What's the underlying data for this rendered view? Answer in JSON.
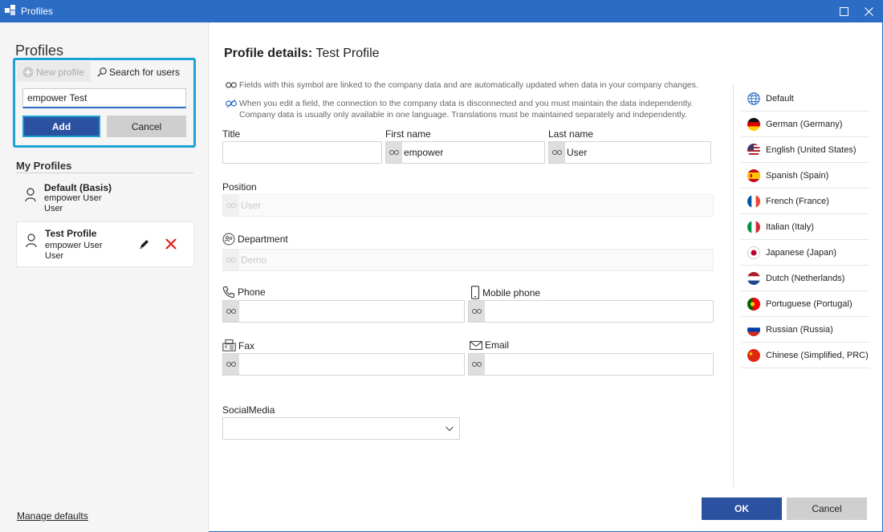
{
  "window": {
    "title": "Profiles",
    "maximize_icon": "maximize-icon",
    "close_icon": "close-icon"
  },
  "sidebar": {
    "title": "Profiles",
    "new_profile_label": "New profile",
    "search_users_label": "Search for users",
    "name_input_value": "empower Test",
    "add_label": "Add",
    "cancel_label": "Cancel",
    "my_profiles_heading": "My Profiles",
    "profiles": [
      {
        "name": "Default (Basis)",
        "line1": "empower User",
        "line2": "User"
      },
      {
        "name": "Test Profile",
        "line1": "empower User",
        "line2": "User"
      }
    ],
    "manage_defaults_label": "Manage defaults"
  },
  "main": {
    "title_bold": "Profile details:",
    "title_rest": " Test Profile",
    "info_linked": "Fields with this symbol are linked to the company data and are automatically updated when data in your company changes.",
    "info_unlinked_1": "When you edit a field, the connection to the company data is disconnected and you must maintain the data independently.",
    "info_unlinked_2": "Company data is usually only available in one language. Translations must be maintained separately and independently.",
    "fields": {
      "title_label": "Title",
      "title_value": "",
      "first_name_label": "First name",
      "first_name_value": "empower",
      "last_name_label": "Last name",
      "last_name_value": "User",
      "position_label": "Position",
      "position_value": "User",
      "department_label": "Department",
      "department_value": "Demo",
      "phone_label": "Phone",
      "phone_value": "",
      "mobile_label": "Mobile phone",
      "mobile_value": "",
      "fax_label": "Fax",
      "fax_value": "",
      "email_label": "Email",
      "email_value": "",
      "social_label": "SocialMedia",
      "social_value": ""
    }
  },
  "languages": [
    "Default",
    "German (Germany)",
    "English (United States)",
    "Spanish (Spain)",
    "French (France)",
    "Italian (Italy)",
    "Japanese (Japan)",
    "Dutch (Netherlands)",
    "Portuguese (Portugal)",
    "Russian (Russia)",
    "Chinese (Simplified, PRC)"
  ],
  "footer": {
    "ok_label": "OK",
    "cancel_label": "Cancel"
  },
  "colors": {
    "titlebar": "#2b6cc4",
    "primary_button": "#2a52a0",
    "highlight": "#1aa3d4",
    "delete": "#e02020"
  }
}
